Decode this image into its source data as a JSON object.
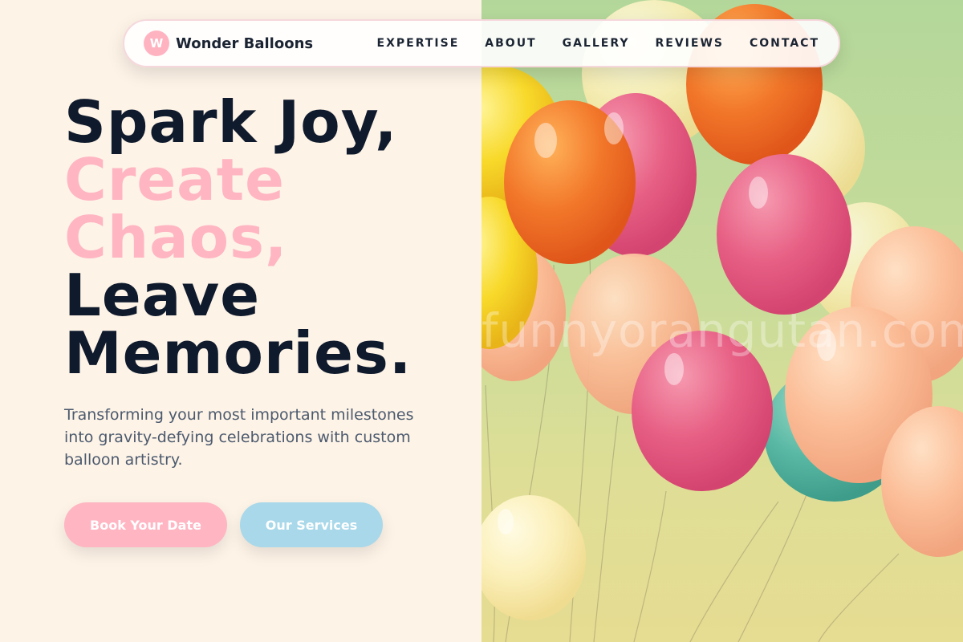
{
  "brand": {
    "logo_letter": "W",
    "name": "Wonder Balloons"
  },
  "nav": {
    "links": [
      "EXPERTISE",
      "ABOUT",
      "GALLERY",
      "REVIEWS",
      "CONTACT"
    ]
  },
  "hero": {
    "title_lines": [
      "Spark Joy,",
      "Create",
      "Chaos,",
      "Leave",
      "Memories."
    ],
    "subtitle": "Transforming your most important milestones into gravity-defying celebrations with custom balloon artistry.",
    "primary_button": "Book Your Date",
    "secondary_button": "Our Services"
  },
  "photo": {
    "watermark": "funnyorangutan.com"
  },
  "colors": {
    "background": "#fdf3e7",
    "accent_pink": "#ffb5c2",
    "accent_blue": "#a8d8ea",
    "text_dark": "#0f1a2c"
  }
}
